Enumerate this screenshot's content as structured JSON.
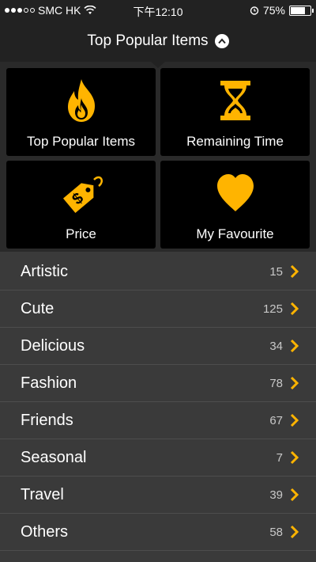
{
  "status_bar": {
    "carrier": "SMC HK",
    "time": "下午12:10",
    "battery": "75%",
    "battery_level": 0.75
  },
  "nav": {
    "title": "Top Popular Items",
    "toggle_icon": "chevron-up-icon"
  },
  "tiles": [
    {
      "label": "Top Popular Items",
      "icon": "flame-icon"
    },
    {
      "label": "Remaining Time",
      "icon": "hourglass-icon"
    },
    {
      "label": "Price",
      "icon": "price-tag-icon"
    },
    {
      "label": "My Favourite",
      "icon": "heart-icon"
    }
  ],
  "categories": [
    {
      "name": "Artistic",
      "count": "15"
    },
    {
      "name": "Cute",
      "count": "125"
    },
    {
      "name": "Delicious",
      "count": "34"
    },
    {
      "name": "Fashion",
      "count": "78"
    },
    {
      "name": "Friends",
      "count": "67"
    },
    {
      "name": "Seasonal",
      "count": "7"
    },
    {
      "name": "Travel",
      "count": "39"
    },
    {
      "name": "Others",
      "count": "58"
    }
  ],
  "colors": {
    "accent": "#ffb400",
    "background": "#3a3a3a",
    "bar": "#222222",
    "tile": "#000000"
  }
}
